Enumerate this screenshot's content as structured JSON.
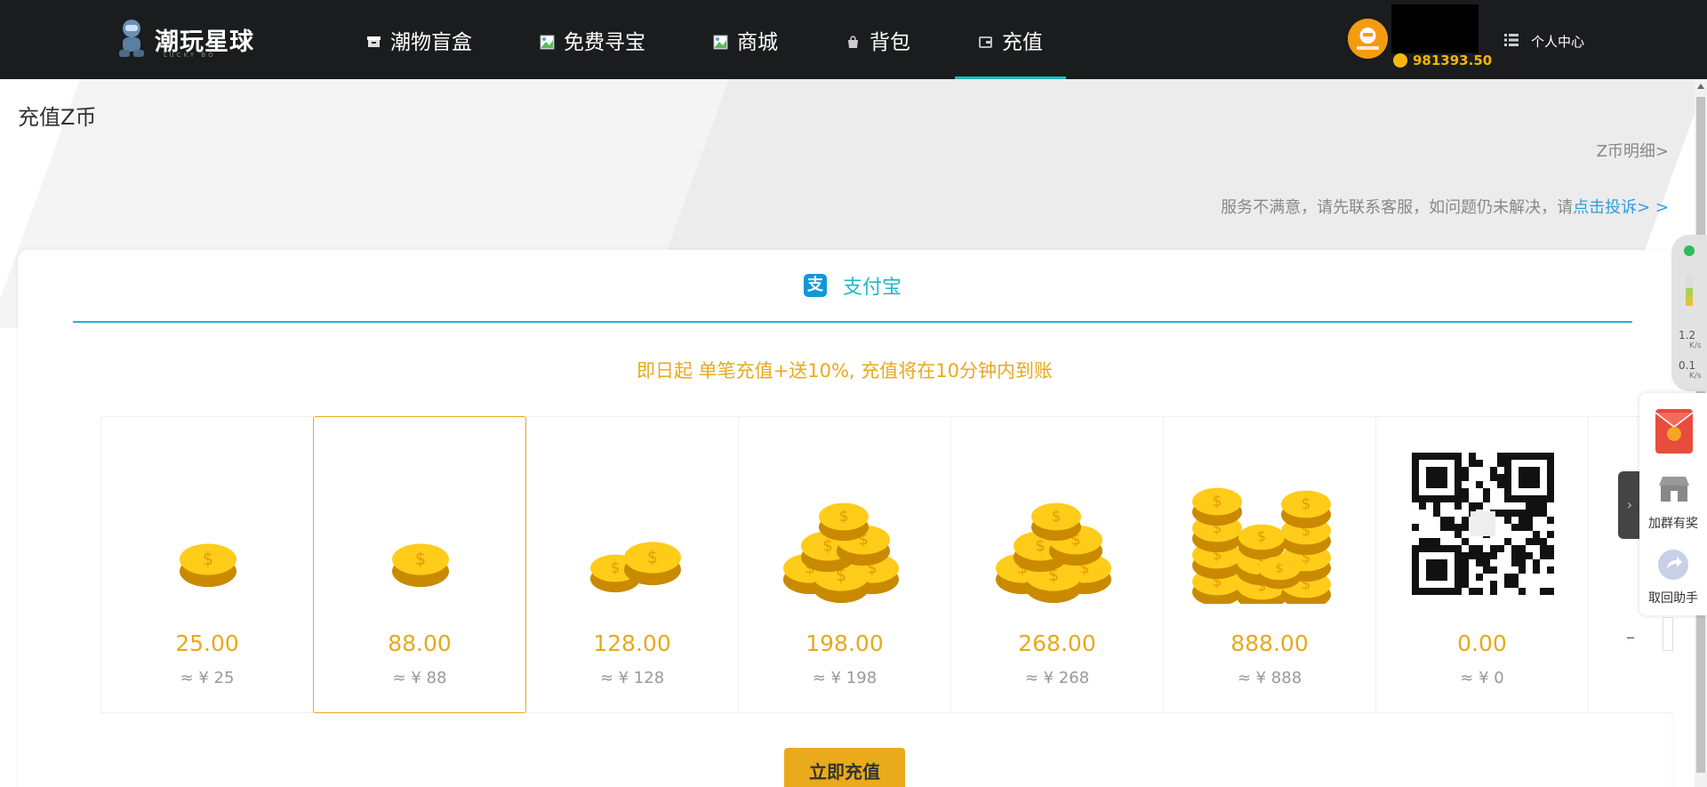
{
  "header": {
    "logo_text": "潮玩星球",
    "logo_sub": "LUCKY BO",
    "nav": [
      {
        "label": "潮物盲盒",
        "icon": "box-icon"
      },
      {
        "label": "免费寻宝",
        "icon": "broken-image-icon"
      },
      {
        "label": "商城",
        "icon": "broken-image-icon"
      },
      {
        "label": "背包",
        "icon": "bag-icon"
      },
      {
        "label": "充值",
        "icon": "wallet-icon",
        "active": true
      }
    ],
    "balance": "981393.50",
    "personal_center": "个人中心"
  },
  "page": {
    "title": "充值Z币",
    "detail_link": "Z币明细>",
    "complaint_text": "服务不满意，请先联系客服，如问题仍未解决，请",
    "complaint_link": "点击投诉> >"
  },
  "payment": {
    "method": "支付宝",
    "promo": "即日起 单笔充值+送10%, 充值将在10分钟内到账",
    "items": [
      {
        "amount": "25.00",
        "price": "≈ ¥ 25",
        "coins": 1
      },
      {
        "amount": "88.00",
        "price": "≈ ¥ 88",
        "coins": 1
      },
      {
        "amount": "128.00",
        "price": "≈ ¥ 128",
        "coins": 2
      },
      {
        "amount": "198.00",
        "price": "≈ ¥ 198",
        "coins": 6
      },
      {
        "amount": "268.00",
        "price": "≈ ¥ 268",
        "coins": 6
      },
      {
        "amount": "888.00",
        "price": "≈ ¥ 888",
        "coins": 12
      },
      {
        "amount": "0.00",
        "price": "≈ ¥ 0",
        "coins": 0
      }
    ],
    "selected_index": 1,
    "button_label": "立即充值"
  },
  "netmon": {
    "up": "1.2",
    "down": "0.1",
    "unit": "K/s"
  },
  "side_panel": {
    "group_label": "加群有奖",
    "assistant_label": "取回助手"
  },
  "colors": {
    "accent": "#1fb8c6",
    "gold": "#e8a91c",
    "header": "#1b1c1e"
  }
}
